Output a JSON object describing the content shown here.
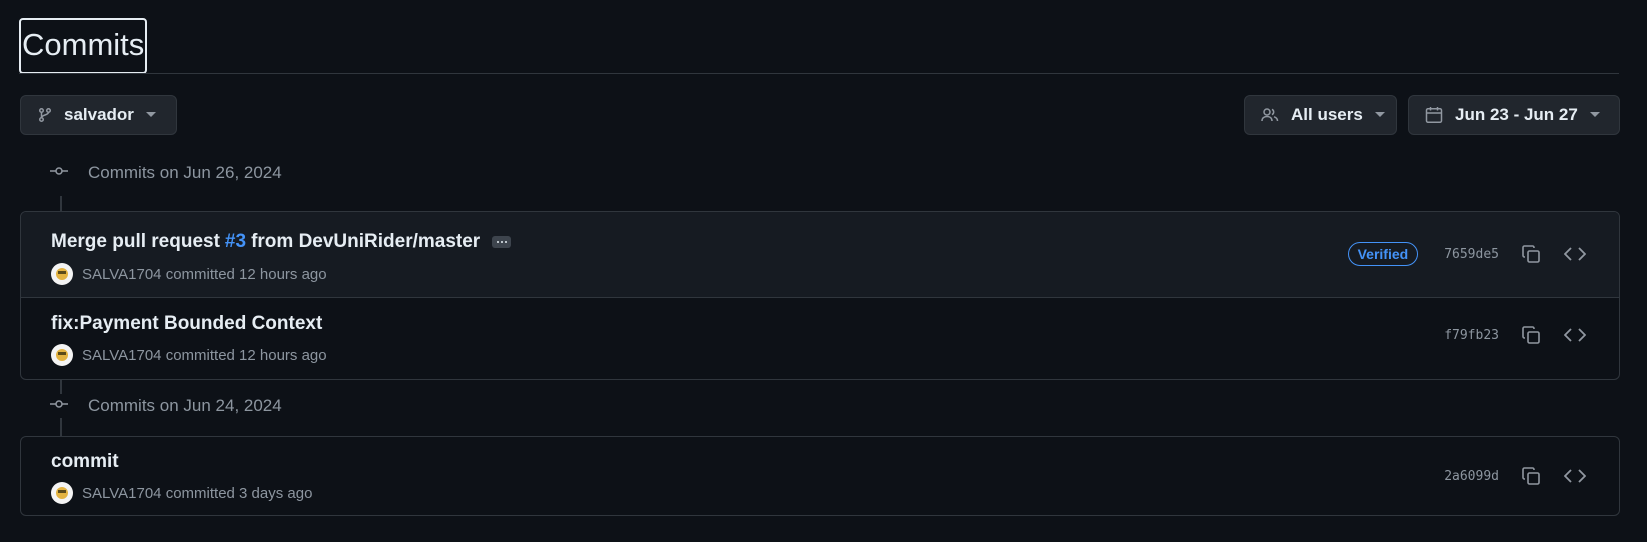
{
  "page": {
    "title": "Commits"
  },
  "filters": {
    "branch": "salvador",
    "users": "All users",
    "date_range": "Jun 23 - Jun 27"
  },
  "groups": [
    {
      "heading": "Commits on Jun 26, 2024",
      "commits": [
        {
          "message_prefix": "Merge pull request",
          "message_link": "#3",
          "message_suffix": "from DevUniRider/master",
          "author": "SALVA1704",
          "meta": "committed 12 hours ago",
          "verified": "Verified",
          "sha": "7659de5"
        },
        {
          "message": "fix:Payment Bounded Context",
          "author": "SALVA1704",
          "meta": "committed 12 hours ago",
          "sha": "f79fb23"
        }
      ]
    },
    {
      "heading": "Commits on Jun 24, 2024",
      "commits": [
        {
          "message": "commit",
          "author": "SALVA1704",
          "meta": "committed 3 days ago",
          "sha": "2a6099d"
        }
      ]
    }
  ],
  "icons": {
    "branch": "git-branch-icon",
    "users": "people-icon",
    "calendar": "calendar-icon",
    "copy": "copy-icon",
    "browse": "code-icon",
    "commit": "git-commit-icon"
  }
}
